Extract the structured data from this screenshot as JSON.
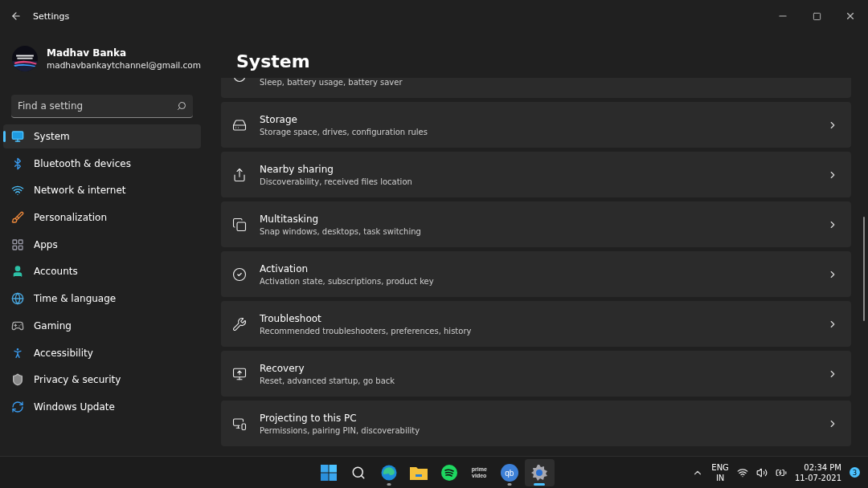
{
  "window": {
    "title": "Settings"
  },
  "user": {
    "name": "Madhav Banka",
    "email": "madhavbankaytchannel@gmail.com"
  },
  "search": {
    "placeholder": "Find a setting"
  },
  "sidebar": {
    "items": [
      {
        "label": "System",
        "selected": true
      },
      {
        "label": "Bluetooth & devices",
        "selected": false
      },
      {
        "label": "Network & internet",
        "selected": false
      },
      {
        "label": "Personalization",
        "selected": false
      },
      {
        "label": "Apps",
        "selected": false
      },
      {
        "label": "Accounts",
        "selected": false
      },
      {
        "label": "Time & language",
        "selected": false
      },
      {
        "label": "Gaming",
        "selected": false
      },
      {
        "label": "Accessibility",
        "selected": false
      },
      {
        "label": "Privacy & security",
        "selected": false
      },
      {
        "label": "Windows Update",
        "selected": false
      }
    ]
  },
  "page": {
    "title": "System",
    "items": [
      {
        "subtitle": "Sleep, battery usage, battery saver"
      },
      {
        "title": "Storage",
        "subtitle": "Storage space, drives, configuration rules"
      },
      {
        "title": "Nearby sharing",
        "subtitle": "Discoverability, received files location"
      },
      {
        "title": "Multitasking",
        "subtitle": "Snap windows, desktops, task switching"
      },
      {
        "title": "Activation",
        "subtitle": "Activation state, subscriptions, product key"
      },
      {
        "title": "Troubleshoot",
        "subtitle": "Recommended troubleshooters, preferences, history"
      },
      {
        "title": "Recovery",
        "subtitle": "Reset, advanced startup, go back"
      },
      {
        "title": "Projecting to this PC",
        "subtitle": "Permissions, pairing PIN, discoverability"
      }
    ]
  },
  "taskbar": {
    "apps": [
      {
        "kind": "start",
        "running": false,
        "selected": false
      },
      {
        "kind": "search",
        "running": false,
        "selected": false
      },
      {
        "kind": "edge",
        "running": true,
        "selected": false
      },
      {
        "kind": "explorer",
        "running": false,
        "selected": false
      },
      {
        "kind": "spotify",
        "running": false,
        "selected": false
      },
      {
        "kind": "prime",
        "lines": [
          "prime",
          "video"
        ],
        "running": false,
        "selected": false
      },
      {
        "kind": "qbit",
        "glyph": "qb",
        "running": true,
        "selected": false
      },
      {
        "kind": "settings",
        "running": true,
        "selected": true
      }
    ],
    "tray": {
      "language": "ENG",
      "region": "IN",
      "time": "02:34 PM",
      "date": "11-07-2021",
      "notifications": "3"
    }
  }
}
